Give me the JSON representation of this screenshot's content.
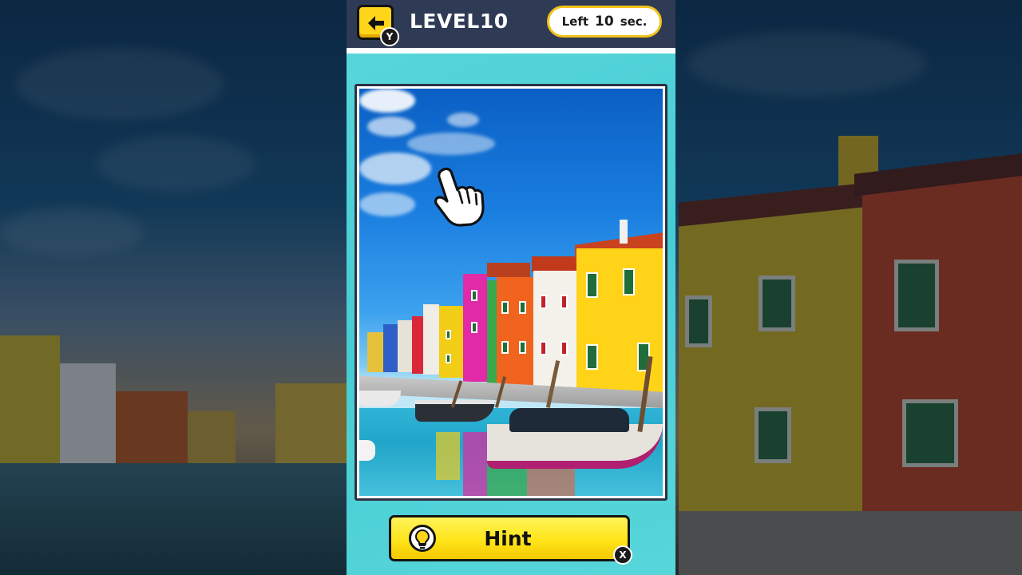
{
  "header": {
    "level_title": "LEVEL10",
    "back_button_badge": "Y",
    "timer": {
      "prefix": "Left",
      "value": "10",
      "unit": "sec."
    }
  },
  "hint": {
    "label": "Hint",
    "button_badge": "X"
  },
  "icons": {
    "back": "arrow-left-icon",
    "pointer": "pointing-hand-icon",
    "hint": "lightbulb-icon"
  },
  "colors": {
    "panel_bg": "#4fd3d8",
    "topbar_bg": "#2f3a55",
    "accent_yellow": "#ffd51a",
    "timer_border": "#f2c21a"
  }
}
